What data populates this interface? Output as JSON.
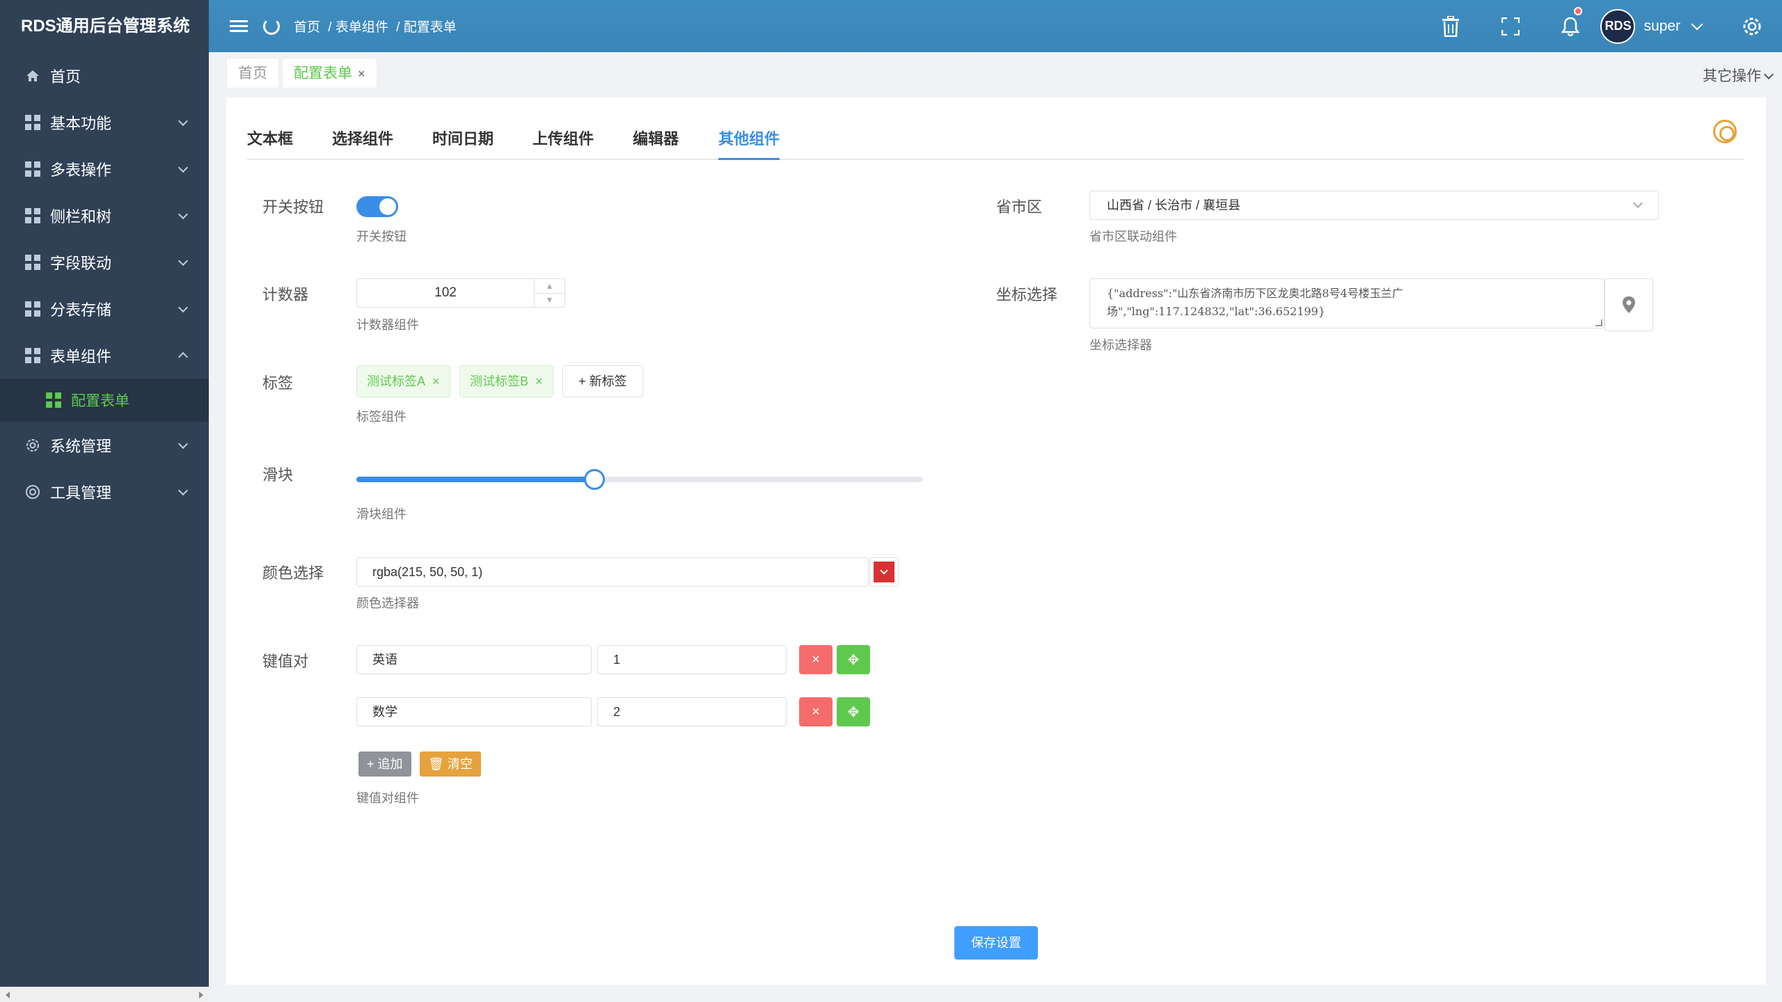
{
  "app": {
    "title": "RDS通用后台管理系统"
  },
  "sidebar": {
    "items": [
      {
        "label": "首页"
      },
      {
        "label": "基本功能"
      },
      {
        "label": "多表操作"
      },
      {
        "label": "侧栏和树"
      },
      {
        "label": "字段联动"
      },
      {
        "label": "分表存储"
      },
      {
        "label": "表单组件"
      },
      {
        "label": "系统管理"
      },
      {
        "label": "工具管理"
      }
    ],
    "sub_item": {
      "label": "配置表单"
    }
  },
  "header": {
    "breadcrumb": [
      "首页",
      "/ 表单组件",
      "/ 配置表单"
    ],
    "avatar_text": "RDS",
    "username": "super"
  },
  "tabbar": {
    "tags": [
      {
        "label": "首页"
      },
      {
        "label": "配置表单",
        "close": "×"
      }
    ],
    "other_ops": "其它操作"
  },
  "tabs": [
    "文本框",
    "选择组件",
    "时间日期",
    "上传组件",
    "编辑器",
    "其他组件"
  ],
  "form": {
    "switch": {
      "label": "开关按钮",
      "hint": "开关按钮",
      "on": true
    },
    "counter": {
      "label": "计数器",
      "value": "102",
      "hint": "计数器组件"
    },
    "tags": {
      "label": "标签",
      "items": [
        "测试标签A",
        "测试标签B"
      ],
      "close": "×",
      "new_label": "+ 新标签",
      "hint": "标签组件"
    },
    "slider": {
      "label": "滑块",
      "value": 0.42,
      "hint": "滑块组件"
    },
    "color": {
      "label": "颜色选择",
      "value": "rgba(215, 50, 50, 1)",
      "swatch": "#d73232",
      "hint": "颜色选择器"
    },
    "kv": {
      "label": "键值对",
      "rows": [
        {
          "key": "英语",
          "value": "1"
        },
        {
          "key": "数学",
          "value": "2"
        }
      ],
      "remove_symbol": "×",
      "add_symbol": "✥",
      "add_label": "+ 追加",
      "clear_label": "🗑 清空",
      "hint": "键值对组件"
    },
    "region": {
      "label": "省市区",
      "value": "山西省 / 长治市 / 襄垣县",
      "hint": "省市区联动组件"
    },
    "coord": {
      "label": "坐标选择",
      "line1": "{\"address\":\"山东省济南市历下区龙奥北路8号4号楼玉兰广",
      "line2": "场\",\"lng\":117.124832,\"lat\":36.652199}",
      "hint": "坐标选择器"
    },
    "save_label": "保存设置"
  },
  "colors": {
    "primary": "#3a8ee6",
    "green": "#5fc94e",
    "red": "#f56c6c",
    "orange": "#e6a23c",
    "sidebar": "#304156",
    "header": "#3c8dbc"
  }
}
